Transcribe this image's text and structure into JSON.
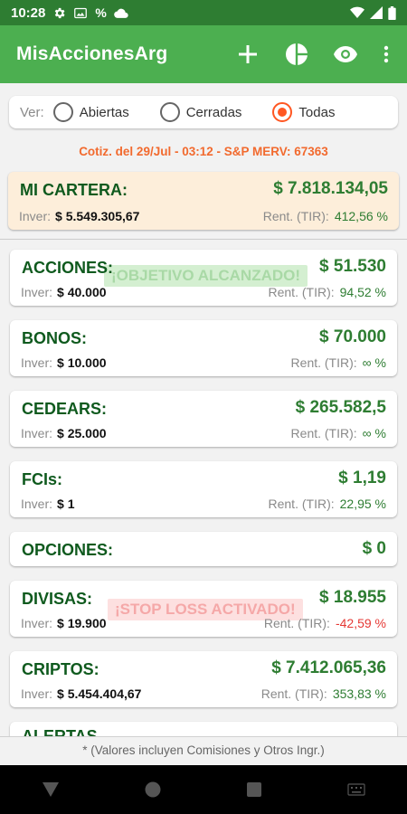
{
  "status_bar": {
    "time": "10:28",
    "percent_icon": "%"
  },
  "app_bar": {
    "title": "MisAccionesArg"
  },
  "filter": {
    "label": "Ver:",
    "options": [
      "Abiertas",
      "Cerradas",
      "Todas"
    ],
    "selected": "Todas"
  },
  "quote": {
    "text": "Cotiz. del 29/Jul - 03:12  -  S&P MERV: 67363"
  },
  "portfolio": {
    "title": "MI CARTERA:",
    "value": "$ 7.818.134,05",
    "inv_label": "Inver:",
    "inv_value": "$ 5.549.305,67",
    "rent_label": "Rent. (TIR):",
    "rent_value": "412,56 %"
  },
  "cards": [
    {
      "title": "ACCIONES:",
      "value": "$ 51.530",
      "inv_label": "Inver:",
      "inv_value": "$ 40.000",
      "rent_label": "Rent. (TIR):",
      "rent_value": "94,52 %",
      "badge": "¡OBJETIVO ALCANZADO!"
    },
    {
      "title": "BONOS:",
      "value": "$ 70.000",
      "inv_label": "Inver:",
      "inv_value": "$ 10.000",
      "rent_label": "Rent. (TIR):",
      "rent_value": "∞ %"
    },
    {
      "title": "CEDEARS:",
      "value": "$ 265.582,5",
      "inv_label": "Inver:",
      "inv_value": "$ 25.000",
      "rent_label": "Rent. (TIR):",
      "rent_value": "∞ %"
    },
    {
      "title": "FCIs:",
      "value": "$ 1,19",
      "inv_label": "Inver:",
      "inv_value": "$ 1",
      "rent_label": "Rent. (TIR):",
      "rent_value": "22,95 %"
    },
    {
      "title": "OPCIONES:",
      "value": "$ 0"
    },
    {
      "title": "DIVISAS:",
      "value": "$ 18.955",
      "inv_label": "Inver:",
      "inv_value": "$ 19.900",
      "rent_label": "Rent. (TIR):",
      "rent_value": "-42,59 %",
      "badge": "¡STOP LOSS ACTIVADO!"
    },
    {
      "title": "CRIPTOS:",
      "value": "$ 7.412.065,36",
      "inv_label": "Inver:",
      "inv_value": "$ 5.454.404,67",
      "rent_label": "Rent. (TIR):",
      "rent_value": "353,83 %"
    }
  ],
  "partial_card": {
    "title": "ALERTAS"
  },
  "footer": {
    "note": "* (Valores incluyen Comisiones y Otros Ingr.)"
  },
  "colors": {
    "status_bar": "#2e7d32",
    "app_bar": "#4caf50",
    "accent": "#ff5722",
    "positive": "#2e7d32",
    "negative": "#e53935",
    "title_green": "#0f5a1e",
    "portfolio_bg": "#fdeeda"
  }
}
